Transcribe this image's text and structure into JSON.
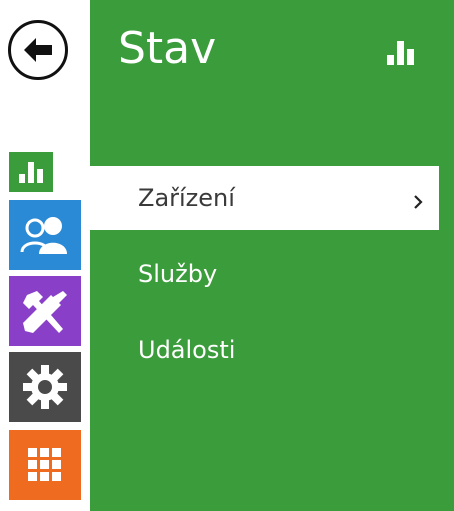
{
  "colors": {
    "main_bg": "#3b9c3b",
    "tile_status": "#3b9c3b",
    "tile_directory": "#2b8ad6",
    "tile_hardware": "#8a3fc9",
    "tile_services": "#4a4a4a",
    "tile_system": "#ef6b1f"
  },
  "sidebar": {
    "back_icon": "arrow-left-icon",
    "tiles": [
      {
        "icon": "bar-chart-icon"
      },
      {
        "icon": "users-icon"
      },
      {
        "icon": "tools-icon"
      },
      {
        "icon": "gear-icon"
      },
      {
        "icon": "grid-icon"
      }
    ]
  },
  "header": {
    "title": "Stav",
    "icon": "bar-chart-icon"
  },
  "menu": {
    "items": [
      {
        "label": "Zařízení",
        "selected": true
      },
      {
        "label": "Služby",
        "selected": false
      },
      {
        "label": "Události",
        "selected": false
      }
    ],
    "chevron": "›"
  }
}
